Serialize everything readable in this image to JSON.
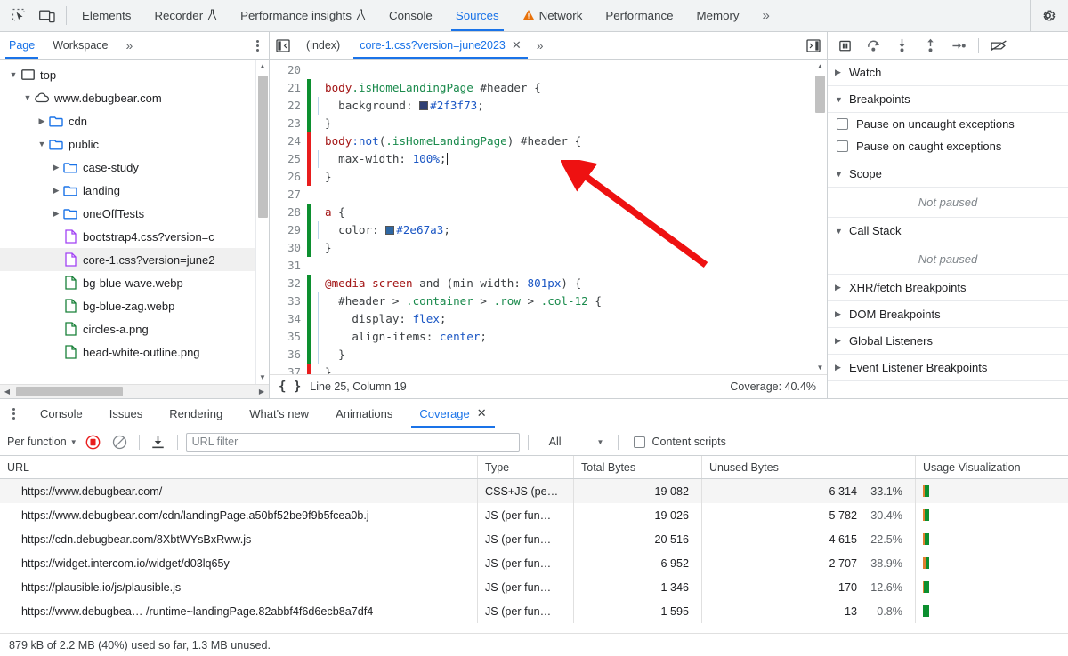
{
  "main_tabs": [
    {
      "label": "Elements",
      "icon": null,
      "active": false
    },
    {
      "label": "Recorder",
      "icon": "flask-icon",
      "active": false
    },
    {
      "label": "Performance insights",
      "icon": "flask-icon",
      "active": false
    },
    {
      "label": "Console",
      "icon": null,
      "active": false
    },
    {
      "label": "Sources",
      "icon": null,
      "active": true
    },
    {
      "label": "Network",
      "icon": "warning-triangle-icon",
      "active": false
    },
    {
      "label": "Performance",
      "icon": null,
      "active": false
    },
    {
      "label": "Memory",
      "icon": null,
      "active": false
    }
  ],
  "main_tabs_overflow": "»",
  "toolbar_icons": {
    "inspect": "inspect-element-icon",
    "device": "device-toolbar-icon",
    "settings": "gear-icon"
  },
  "navigator": {
    "tabs": [
      {
        "label": "Page",
        "active": true
      },
      {
        "label": "Workspace",
        "active": false
      }
    ],
    "overflow": "»",
    "more_options": "kebab-menu-icon",
    "tree": [
      {
        "label": "top",
        "depth": 0,
        "twisty": "down",
        "icon": "frame-icon",
        "selected": false
      },
      {
        "label": "www.debugbear.com",
        "depth": 1,
        "twisty": "down",
        "icon": "cloud-icon",
        "selected": false
      },
      {
        "label": "cdn",
        "depth": 2,
        "twisty": "right",
        "icon": "folder-icon",
        "selected": false
      },
      {
        "label": "public",
        "depth": 2,
        "twisty": "down",
        "icon": "folder-icon",
        "selected": false
      },
      {
        "label": "case-study",
        "depth": 3,
        "twisty": "right",
        "icon": "folder-icon",
        "selected": false
      },
      {
        "label": "landing",
        "depth": 3,
        "twisty": "right",
        "icon": "folder-icon",
        "selected": false
      },
      {
        "label": "oneOffTests",
        "depth": 3,
        "twisty": "right",
        "icon": "folder-icon",
        "selected": false
      },
      {
        "label": "bootstrap4.css?version=c",
        "depth": 3,
        "twisty": "none",
        "icon": "css-file-icon",
        "selected": false
      },
      {
        "label": "core-1.css?version=june2",
        "depth": 3,
        "twisty": "none",
        "icon": "css-file-icon",
        "selected": true
      },
      {
        "label": "bg-blue-wave.webp",
        "depth": 3,
        "twisty": "none",
        "icon": "image-file-icon",
        "selected": false
      },
      {
        "label": "bg-blue-zag.webp",
        "depth": 3,
        "twisty": "none",
        "icon": "image-file-icon",
        "selected": false
      },
      {
        "label": "circles-a.png",
        "depth": 3,
        "twisty": "none",
        "icon": "image-file-icon",
        "selected": false
      },
      {
        "label": "head-white-outline.png",
        "depth": 3,
        "twisty": "none",
        "icon": "image-file-icon",
        "selected": false
      }
    ]
  },
  "editor": {
    "back_button": "show-navigator-icon",
    "tabs": [
      {
        "label": "(index)",
        "active": false,
        "closable": false
      },
      {
        "label": "core-1.css?version=june2023",
        "active": true,
        "closable": true
      }
    ],
    "overflow": "»",
    "panel_toggle": "show-debugger-icon",
    "status": {
      "format_icon": "pretty-print-braces-icon",
      "position": "Line 25, Column 19",
      "coverage": "Coverage: 40.4%"
    },
    "lines": [
      {
        "n": "20",
        "coverage": "none",
        "indent": false,
        "text": ""
      },
      {
        "n": "21",
        "coverage": "green",
        "indent": false,
        "tokens": [
          {
            "t": "body",
            "c": "k-tag"
          },
          {
            "t": ".isHomeLandingPage",
            "c": "k-cls"
          },
          {
            "t": " #header {",
            "c": "k-punct"
          }
        ]
      },
      {
        "n": "22",
        "coverage": "green",
        "indent": true,
        "tokens": [
          {
            "t": "  background: ",
            "c": "k-prop"
          },
          {
            "t": "@swatch#2f3f73",
            "c": "swatch"
          },
          {
            "t": "#2f3f73",
            "c": "k-val"
          },
          {
            "t": ";",
            "c": "k-punct"
          }
        ]
      },
      {
        "n": "23",
        "coverage": "green",
        "indent": false,
        "tokens": [
          {
            "t": "}",
            "c": "k-punct"
          }
        ]
      },
      {
        "n": "24",
        "coverage": "red",
        "indent": false,
        "tokens": [
          {
            "t": "body",
            "c": "k-tag"
          },
          {
            "t": ":not",
            "c": "k-pseudo"
          },
          {
            "t": "(",
            "c": "k-punct"
          },
          {
            "t": ".isHomeLandingPage",
            "c": "k-cls"
          },
          {
            "t": ") #header {",
            "c": "k-punct"
          }
        ]
      },
      {
        "n": "25",
        "coverage": "red",
        "indent": true,
        "tokens": [
          {
            "t": "  max-width: ",
            "c": "k-prop"
          },
          {
            "t": "100%",
            "c": "k-val"
          },
          {
            "t": ";",
            "c": "k-punct"
          },
          {
            "t": "@caret",
            "c": "caret"
          }
        ]
      },
      {
        "n": "26",
        "coverage": "red",
        "indent": false,
        "tokens": [
          {
            "t": "}",
            "c": "k-punct"
          }
        ]
      },
      {
        "n": "27",
        "coverage": "none",
        "indent": false,
        "tokens": []
      },
      {
        "n": "28",
        "coverage": "green",
        "indent": false,
        "tokens": [
          {
            "t": "a",
            "c": "k-tag"
          },
          {
            "t": " {",
            "c": "k-punct"
          }
        ]
      },
      {
        "n": "29",
        "coverage": "green",
        "indent": true,
        "tokens": [
          {
            "t": "  color: ",
            "c": "k-prop"
          },
          {
            "t": "@swatch#2e67a3",
            "c": "swatch"
          },
          {
            "t": "#2e67a3",
            "c": "k-val"
          },
          {
            "t": ";",
            "c": "k-punct"
          }
        ]
      },
      {
        "n": "30",
        "coverage": "green",
        "indent": false,
        "tokens": [
          {
            "t": "}",
            "c": "k-punct"
          }
        ]
      },
      {
        "n": "31",
        "coverage": "none",
        "indent": false,
        "tokens": []
      },
      {
        "n": "32",
        "coverage": "green",
        "indent": false,
        "tokens": [
          {
            "t": "@media",
            "c": "k-sel"
          },
          {
            "t": " ",
            "c": "k-punct"
          },
          {
            "t": "screen",
            "c": "k-sel"
          },
          {
            "t": " and (min-width: ",
            "c": "k-punct"
          },
          {
            "t": "801px",
            "c": "k-val"
          },
          {
            "t": ") {",
            "c": "k-punct"
          }
        ]
      },
      {
        "n": "33",
        "coverage": "green",
        "indent": true,
        "tokens": [
          {
            "t": "  #header",
            "c": "k-id"
          },
          {
            "t": " > ",
            "c": "k-punct"
          },
          {
            "t": ".container",
            "c": "k-cls"
          },
          {
            "t": " > ",
            "c": "k-punct"
          },
          {
            "t": ".row",
            "c": "k-cls"
          },
          {
            "t": " > ",
            "c": "k-punct"
          },
          {
            "t": ".col-12",
            "c": "k-cls"
          },
          {
            "t": " {",
            "c": "k-punct"
          }
        ]
      },
      {
        "n": "34",
        "coverage": "green",
        "indent": true,
        "tokens": [
          {
            "t": "    display: ",
            "c": "k-prop"
          },
          {
            "t": "flex",
            "c": "k-val"
          },
          {
            "t": ";",
            "c": "k-punct"
          }
        ]
      },
      {
        "n": "35",
        "coverage": "green",
        "indent": true,
        "tokens": [
          {
            "t": "    align-items: ",
            "c": "k-prop"
          },
          {
            "t": "center",
            "c": "k-val"
          },
          {
            "t": ";",
            "c": "k-punct"
          }
        ]
      },
      {
        "n": "36",
        "coverage": "green",
        "indent": true,
        "tokens": [
          {
            "t": "  }",
            "c": "k-punct"
          }
        ]
      },
      {
        "n": "37",
        "coverage": "red",
        "indent": false,
        "tokens": [
          {
            "t": "}",
            "c": "k-punct"
          }
        ]
      }
    ]
  },
  "debugger": {
    "controls": [
      {
        "name": "pause-script-execution",
        "icon": "pause-icon"
      },
      {
        "name": "step-over",
        "icon": "step-over-icon"
      },
      {
        "name": "step-into",
        "icon": "step-into-icon"
      },
      {
        "name": "step-out",
        "icon": "step-out-icon"
      },
      {
        "name": "step",
        "icon": "step-icon"
      },
      {
        "name": "deactivate-breakpoints",
        "icon": "deactivate-breakpoints-icon"
      }
    ],
    "sections": [
      {
        "label": "Watch",
        "expanded": false
      },
      {
        "label": "Breakpoints",
        "expanded": true
      },
      {
        "label": "Scope",
        "expanded": true
      },
      {
        "label": "Call Stack",
        "expanded": true
      },
      {
        "label": "XHR/fetch Breakpoints",
        "expanded": false
      },
      {
        "label": "DOM Breakpoints",
        "expanded": false
      },
      {
        "label": "Global Listeners",
        "expanded": false
      },
      {
        "label": "Event Listener Breakpoints",
        "expanded": false
      }
    ],
    "breakpoint_options": [
      {
        "label": "Pause on uncaught exceptions",
        "checked": false
      },
      {
        "label": "Pause on caught exceptions",
        "checked": false
      }
    ],
    "scope_empty": "Not paused",
    "callstack_empty": "Not paused"
  },
  "drawer": {
    "more_options": "kebab-menu-icon",
    "tabs": [
      {
        "label": "Console",
        "active": false,
        "closable": false
      },
      {
        "label": "Issues",
        "active": false,
        "closable": false
      },
      {
        "label": "Rendering",
        "active": false,
        "closable": false
      },
      {
        "label": "What's new",
        "active": false,
        "closable": false
      },
      {
        "label": "Animations",
        "active": false,
        "closable": false
      },
      {
        "label": "Coverage",
        "active": true,
        "closable": true
      }
    ],
    "coverage_toolbar": {
      "mode": "Per function",
      "record_icon": "record-stop-icon",
      "clear_icon": "clear-icon",
      "export_icon": "export-download-icon",
      "filter_placeholder": "URL filter",
      "filter_value": "",
      "type_filter": "All",
      "content_scripts_label": "Content scripts",
      "content_scripts_checked": false
    },
    "coverage_table": {
      "columns": [
        "URL",
        "Type",
        "Total Bytes",
        "Unused Bytes",
        "Usage Visualization"
      ],
      "rows": [
        {
          "url": "https://www.debugbear.com/",
          "type": "CSS+JS (pe…",
          "total": "19 082",
          "unused": "6 314",
          "pct": "33.1%",
          "used_ratio": 0.669
        },
        {
          "url": "https://www.debugbear.com/cdn/landingPage.a50bf52be9f9b5fcea0b.j",
          "type": "JS (per fun…",
          "total": "19 026",
          "unused": "5 782",
          "pct": "30.4%",
          "used_ratio": 0.696
        },
        {
          "url": "https://cdn.debugbear.com/8XbtWYsBxRww.js",
          "type": "JS (per fun…",
          "total": "20 516",
          "unused": "4 615",
          "pct": "22.5%",
          "used_ratio": 0.775
        },
        {
          "url": "https://widget.intercom.io/widget/d03lq65y",
          "type": "JS (per fun…",
          "total": "6 952",
          "unused": "2 707",
          "pct": "38.9%",
          "used_ratio": 0.611
        },
        {
          "url": "https://plausible.io/js/plausible.js",
          "type": "JS (per fun…",
          "total": "1 346",
          "unused": "170",
          "pct": "12.6%",
          "used_ratio": 0.874
        },
        {
          "url": "https://www.debugbea… /runtime~landingPage.82abbf4f6d6ecb8a7df4",
          "type": "JS (per fun…",
          "total": "1 595",
          "unused": "13",
          "pct": "0.8%",
          "used_ratio": 0.992
        }
      ]
    },
    "coverage_footer": "879 kB of 2.2 MB (40%) used so far, 1.3 MB unused."
  },
  "annotation": {
    "arrow_color": "#ee1111"
  }
}
